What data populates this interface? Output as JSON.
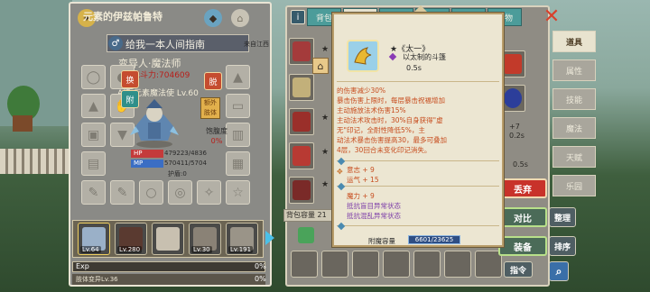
{
  "character": {
    "title": "元素的伊兹帕鲁特",
    "guide_label": "给我一本人间指南",
    "from_label": "来自江西",
    "job": "变异人·魔法师",
    "power": "战斗力:704609",
    "level_label": "A级 元素魔法使 Lv.60",
    "equip_buttons": [
      "换",
      "附",
      "脱"
    ],
    "extra_body_label": "额外肢体",
    "satiety_label": "饱腹度",
    "satiety_value": "0%",
    "hp_label": "HP",
    "hp_value": "479223/4836",
    "mp_label": "MP",
    "mp_value": "570411/5704",
    "shield_label": "护盾:0",
    "party": [
      {
        "level": "Lv.64"
      },
      {
        "level": "Lv.280"
      },
      {
        "level": ""
      },
      {
        "level": "Lv.30"
      },
      {
        "level": "Lv.191"
      }
    ],
    "exp_label": "Exp",
    "exp_value": "0%",
    "sub_label": "肢体变异Lv.36",
    "sub_value": "0%"
  },
  "inventory": {
    "info_icon": "i",
    "tabs": [
      "背包",
      "装备",
      "首饰",
      "药品",
      "技能",
      "杂物"
    ],
    "active_tab": 1,
    "capacity_label": "背包容量 21",
    "stat_rows": [
      {
        "value": "+7"
      },
      {
        "value": "0.2s"
      },
      {
        "value": "0.5s"
      }
    ],
    "close_icon": "close-icon"
  },
  "tooltip": {
    "name": "★《太一》",
    "material": "以太制的斗篷",
    "time": "0.5s",
    "description": [
      "的伤害减少30%",
      "暴击伤害上限时，每层暴击祝福增加",
      "主动施放法术伤害15%",
      "主动法术攻击时，30%自身获得\"虚",
      "无\"印记，全耐性降低5%，主",
      "动法术暴击伤害提高30，最多可叠加",
      "4层，30回合未变化印记消失。"
    ],
    "stats_a": [
      "意志 + 9",
      "运气 + 15"
    ],
    "stats_b": [
      "魔力 + 9",
      "抵抗盲目异常状态",
      "抵抗混乱异常状态"
    ],
    "capacity_label": "附魔容量",
    "capacity_value": "6601/23625"
  },
  "side": {
    "tabs": [
      "道具",
      "属性",
      "技能",
      "魔法",
      "天赋",
      "乐园"
    ],
    "active": 0,
    "discard": "丢弃",
    "compare": "对比",
    "tidy": "整理",
    "equip": "装备",
    "sort": "排序",
    "command": "指令"
  }
}
